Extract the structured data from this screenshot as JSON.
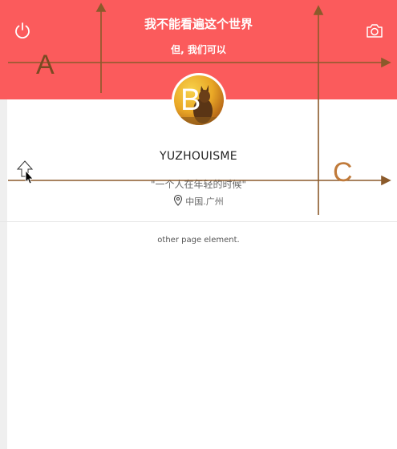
{
  "header": {
    "title": "我不能看遍这个世界",
    "subtitle": "但, 我们可以",
    "background": "#fb5b5c"
  },
  "icons": {
    "power": "power-icon",
    "camera": "camera-icon",
    "location": "map-pin-icon",
    "cursor": "mouse-pointer-icon"
  },
  "profile": {
    "avatar_letter": "B",
    "username": "YUZHOUISME",
    "motto": "\"一个人在年轻的时候\"",
    "location": "中国.广州"
  },
  "content": {
    "other_text": "other page element."
  },
  "annotations": {
    "label_a": "A",
    "label_c": "C",
    "axis_color": "#8b5a2b"
  }
}
